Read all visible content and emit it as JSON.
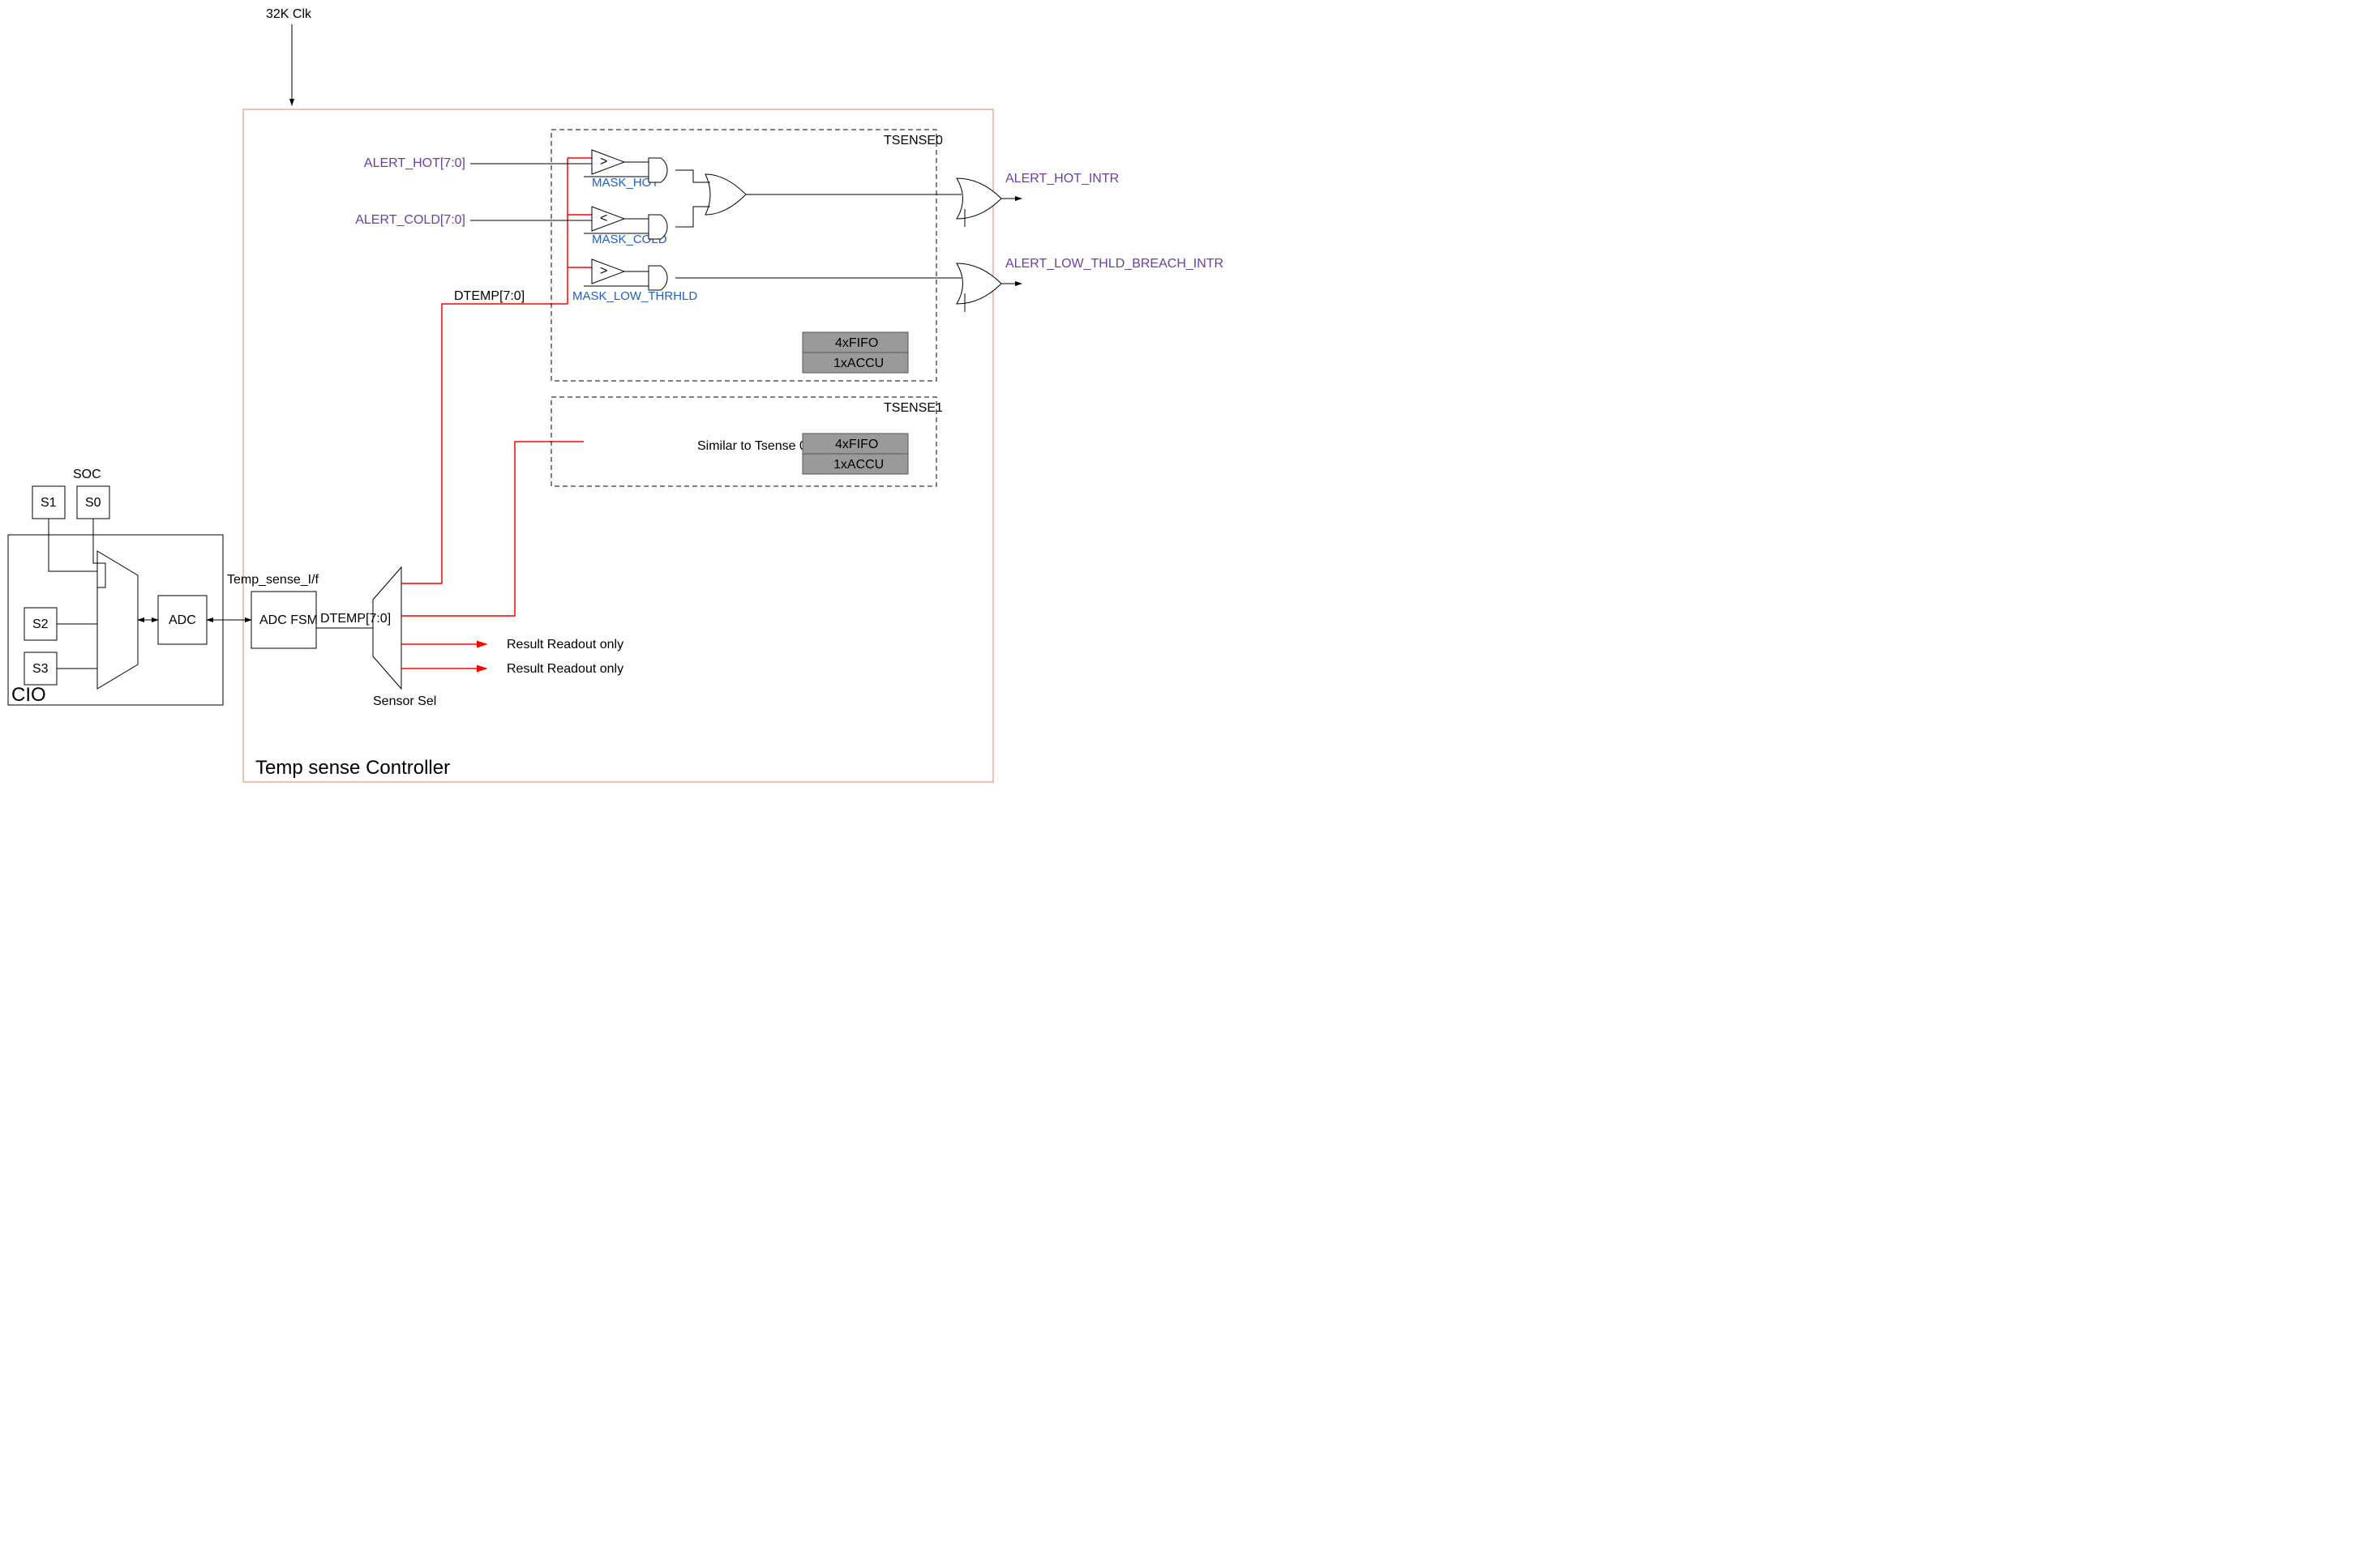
{
  "title": "Temp sense Controller",
  "clk": "32K Clk",
  "cio": {
    "label": "CIO",
    "soc": "SOC",
    "s0": "S0",
    "s1": "S1",
    "s2": "S2",
    "s3": "S3",
    "adc": "ADC",
    "temp_if": "Temp_sense_I/f"
  },
  "fsm": "ADC FSM",
  "dtemp_fsm": "DTEMP[7:0]",
  "sensor_sel": "Sensor Sel",
  "readout1": "Result Readout only",
  "readout2": "Result Readout only",
  "dtemp_bus": "DTEMP[7:0]",
  "alert_hot_in": "ALERT_HOT[7:0]",
  "alert_cold_in": "ALERT_COLD[7:0]",
  "mask_hot": "MASK_HOT",
  "mask_cold": "MASK_COLD",
  "mask_low": "MASK_LOW_THRHLD",
  "cmp_gt1": ">",
  "cmp_lt": "<",
  "cmp_gt2": ">",
  "tsense0": {
    "title": "TSENSE0",
    "fifo": "4xFIFO",
    "accu": "1xACCU"
  },
  "tsense1": {
    "title": "TSENSE1",
    "note": "Similar to Tsense 0",
    "fifo": "4xFIFO",
    "accu": "1xACCU"
  },
  "out_hot": "ALERT_HOT_INTR",
  "out_low": "ALERT_LOW_THLD_BREACH_INTR"
}
